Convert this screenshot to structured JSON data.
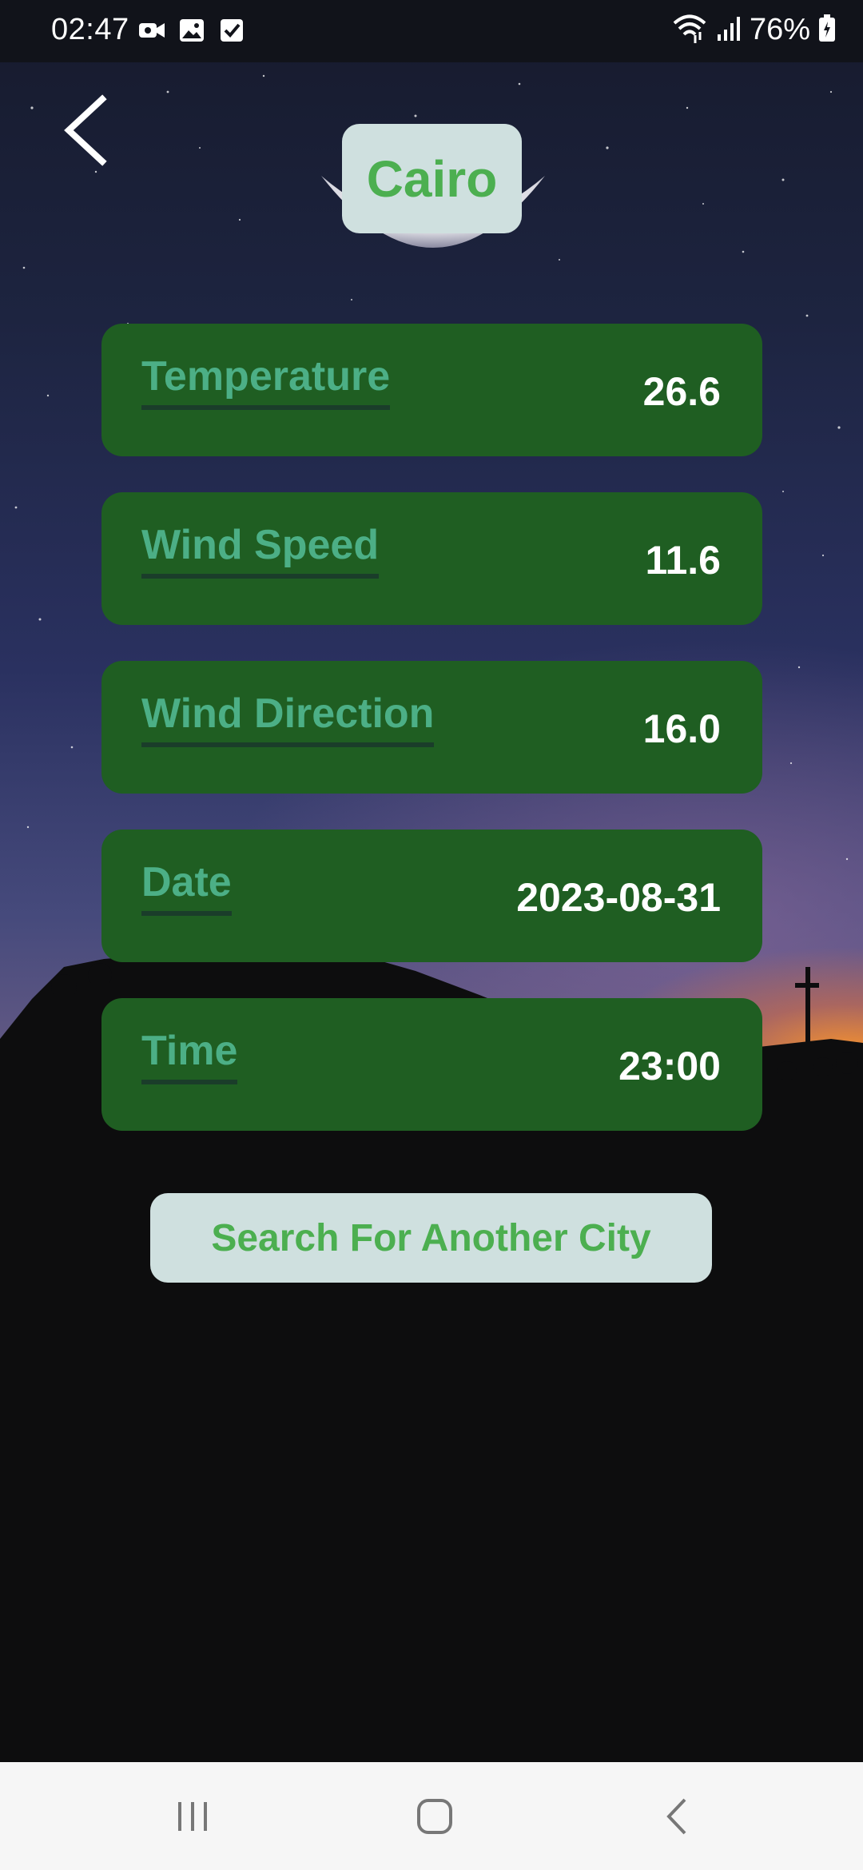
{
  "status_bar": {
    "time": "02:47",
    "battery": "76%",
    "icons": [
      "video-icon",
      "image-icon",
      "checkbox-icon",
      "wifi-icon",
      "signal-icon",
      "battery-icon"
    ]
  },
  "header": {
    "back_icon": "back-arrow-icon",
    "city": "Cairo"
  },
  "weather": {
    "items": [
      {
        "label": "Temperature",
        "value": "26.6"
      },
      {
        "label": "Wind Speed",
        "value": "11.6"
      },
      {
        "label": "Wind Direction",
        "value": "16.0"
      },
      {
        "label": "Date",
        "value": "2023-08-31"
      },
      {
        "label": "Time",
        "value": "23:00"
      }
    ]
  },
  "actions": {
    "search_label": "Search For Another City"
  },
  "nav_bar": {
    "icons": [
      "recent-apps-icon",
      "home-icon",
      "back-icon"
    ]
  },
  "colors": {
    "card_bg": "#1f5e22",
    "label_green": "#4caf86",
    "title_green": "#4caf50",
    "pill_bg": "#cfe0df"
  }
}
